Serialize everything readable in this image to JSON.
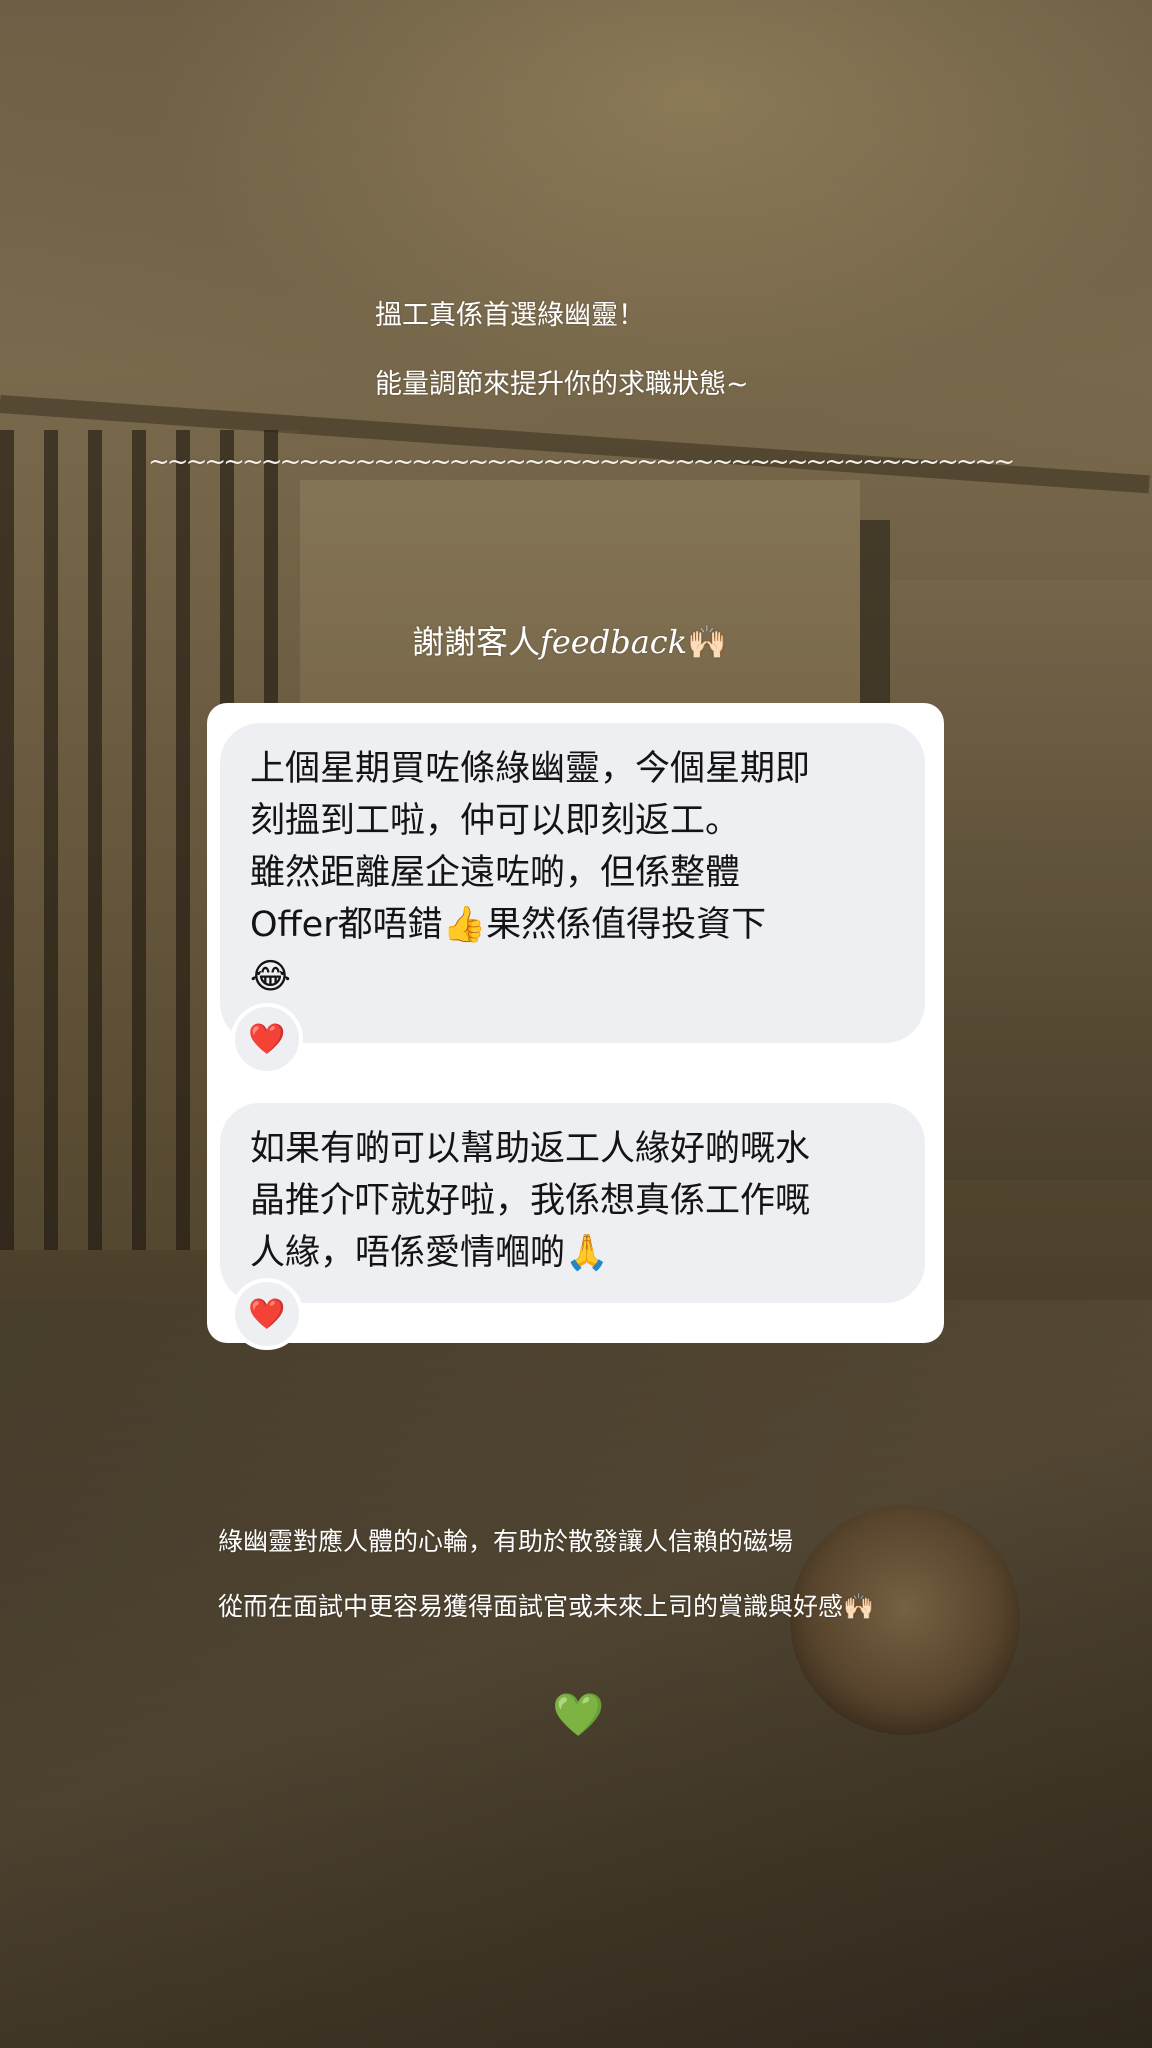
{
  "story": {
    "headline_line1": "搵工真係首選綠幽靈！",
    "headline_line2": "能量調節來提升你的求職狀態~",
    "divider": "~~~~~~~~~~~~~~~~~~~~~~~~~~~~~~~~~~~~~~~~~~~~~~",
    "thanks_prefix": "謝謝客人",
    "thanks_script": "feedback",
    "thanks_emoji": "🙌🏻",
    "info_line1": "綠幽靈對應人體的心輪，有助於散發讓人信賴的磁場",
    "info_line2": "從而在面試中更容易獲得面試官或未來上司的賞識與好感🙌🏻",
    "closing_emoji": "💚"
  },
  "feedback": {
    "message1": {
      "lines": [
        "上個星期買咗條綠幽靈，今個星期即",
        "刻搵到工啦，仲可以即刻返工。",
        "雖然距離屋企遠咗啲，但係整體",
        "Offer都唔錯👍果然係值得投資下",
        "😂"
      ],
      "reaction": "❤️"
    },
    "message2": {
      "lines": [
        "如果有啲可以幫助返工人緣好啲嘅水",
        "晶推介吓就好啦，我係想真係工作嘅",
        "人緣，唔係愛情嗰啲🙏"
      ],
      "reaction": "❤️"
    }
  },
  "colors": {
    "overlay_text": "#ffffff",
    "card_background": "#ffffff",
    "bubble_background": "#eeeff3",
    "message_text": "#141414"
  }
}
